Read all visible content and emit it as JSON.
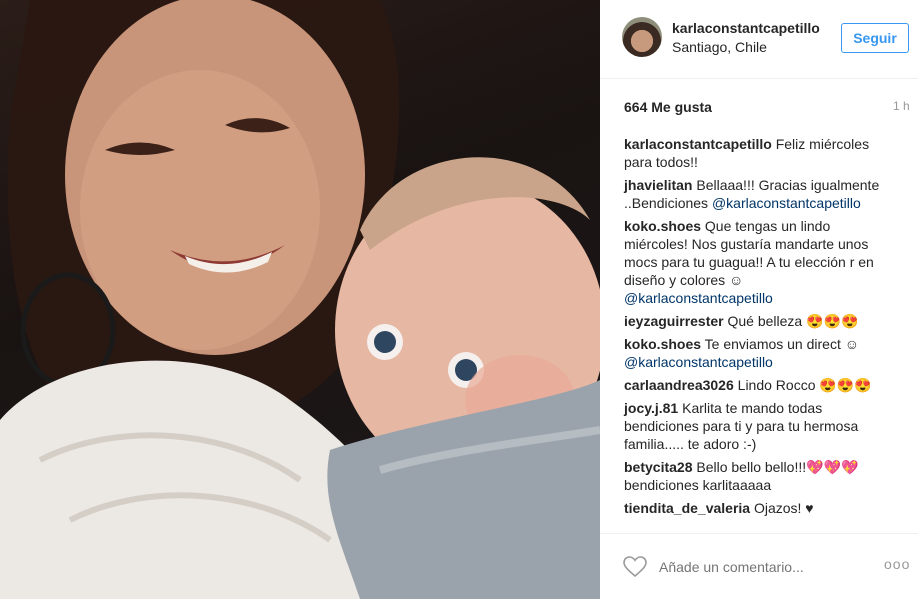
{
  "post": {
    "photo_alt": "",
    "likes": "664 Me gusta",
    "time": "1 h"
  },
  "header": {
    "username": "karlaconstantcapetillo",
    "location": "Santiago, Chile",
    "follow_label": "Seguir"
  },
  "comments": [
    {
      "user": "karlaconstantcapetillo",
      "text": " Feliz miércoles para todos!!",
      "mention": ""
    },
    {
      "user": "jhavielitan",
      "text": " Bellaaa!!! Gracias igualmente ..Bendiciones ",
      "mention": "@karlaconstantcapetillo"
    },
    {
      "user": "koko.shoes",
      "text": " Que tengas un lindo miércoles! Nos gustaría mandarte unos mocs para tu guagua!! A tu elección r en diseño y colores ☺ ",
      "mention": "@karlaconstantcapetillo"
    },
    {
      "user": "ieyzaguirrester",
      "text": " Qué belleza 😍😍😍",
      "mention": ""
    },
    {
      "user": "koko.shoes",
      "text": " Te enviamos un direct ☺ ",
      "mention": "@karlaconstantcapetillo"
    },
    {
      "user": "carlaandrea3026",
      "text": " Lindo Rocco 😍😍😍",
      "mention": ""
    },
    {
      "user": "jocy.j.81",
      "text": " Karlita te mando todas bendiciones para ti y para tu hermosa familia..... te adoro :-)",
      "mention": ""
    },
    {
      "user": "betycita28",
      "text": " Bello bello bello!!!💖💖💖 bendiciones karlitaaaaa",
      "mention": ""
    },
    {
      "user": "tiendita_de_valeria",
      "text": " Ojazos! ♥",
      "mention": ""
    }
  ],
  "footer": {
    "comment_placeholder": "Añade un comentario...",
    "more_label": "ooo"
  },
  "icons": {
    "like": "heart-icon",
    "more": "more-options-icon"
  },
  "colors": {
    "accent": "#3897f0",
    "mention": "#003569",
    "muted": "#999999"
  }
}
